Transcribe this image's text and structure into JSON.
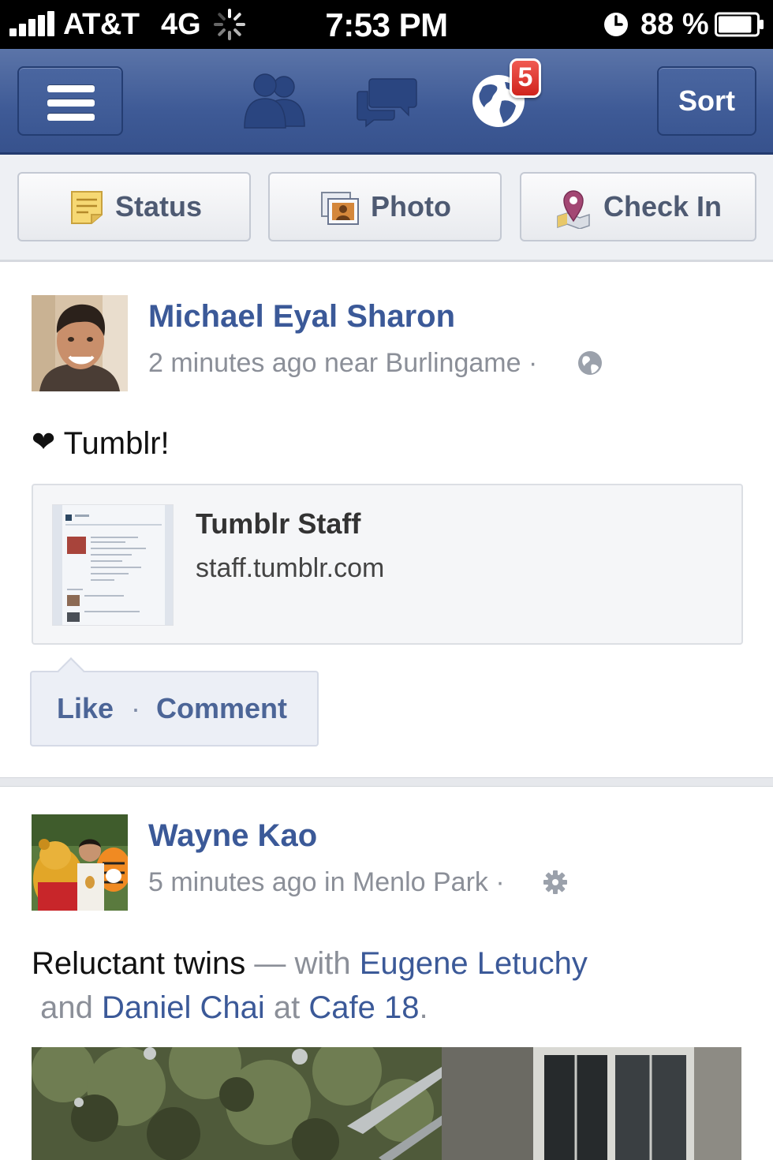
{
  "status_bar": {
    "carrier": "AT&T",
    "network": "4G",
    "time": "7:53 PM",
    "battery_percent": "88 %",
    "battery_level": 0.88
  },
  "nav_bar": {
    "menu_icon": "hamburger-menu-icon",
    "friends_icon": "friend-requests-icon",
    "messages_icon": "messages-icon",
    "notifications_icon": "globe-notifications-icon",
    "notification_count": "5",
    "sort_label": "Sort",
    "colors": {
      "bar": "#3e5a96",
      "badge": "#d0231c"
    }
  },
  "action_bar": {
    "status_label": "Status",
    "photo_label": "Photo",
    "checkin_label": "Check In"
  },
  "feed": {
    "posts": [
      {
        "author": "Michael Eyal Sharon",
        "meta": "2 minutes ago near Burlingame ·",
        "privacy_icon": "globe-icon",
        "heart": "❤",
        "text": "Tumblr!",
        "link": {
          "title": "Tumblr Staff",
          "url": "staff.tumblr.com"
        },
        "actions": {
          "like": "Like",
          "separator": "·",
          "comment": "Comment"
        }
      },
      {
        "author": "Wayne Kao",
        "meta": "5 minutes ago in Menlo Park ·",
        "privacy_icon": "gear-icon",
        "caption": {
          "text": "Reluctant twins",
          "dash_with": " — with ",
          "friend1": "Eugene Letuchy",
          "and": " and ",
          "friend2": "Daniel Chai",
          "at": " at ",
          "place": "Cafe 18",
          "period": "."
        }
      }
    ]
  },
  "colors": {
    "link_blue": "#3b5998",
    "meta_gray": "#8b8f98"
  }
}
